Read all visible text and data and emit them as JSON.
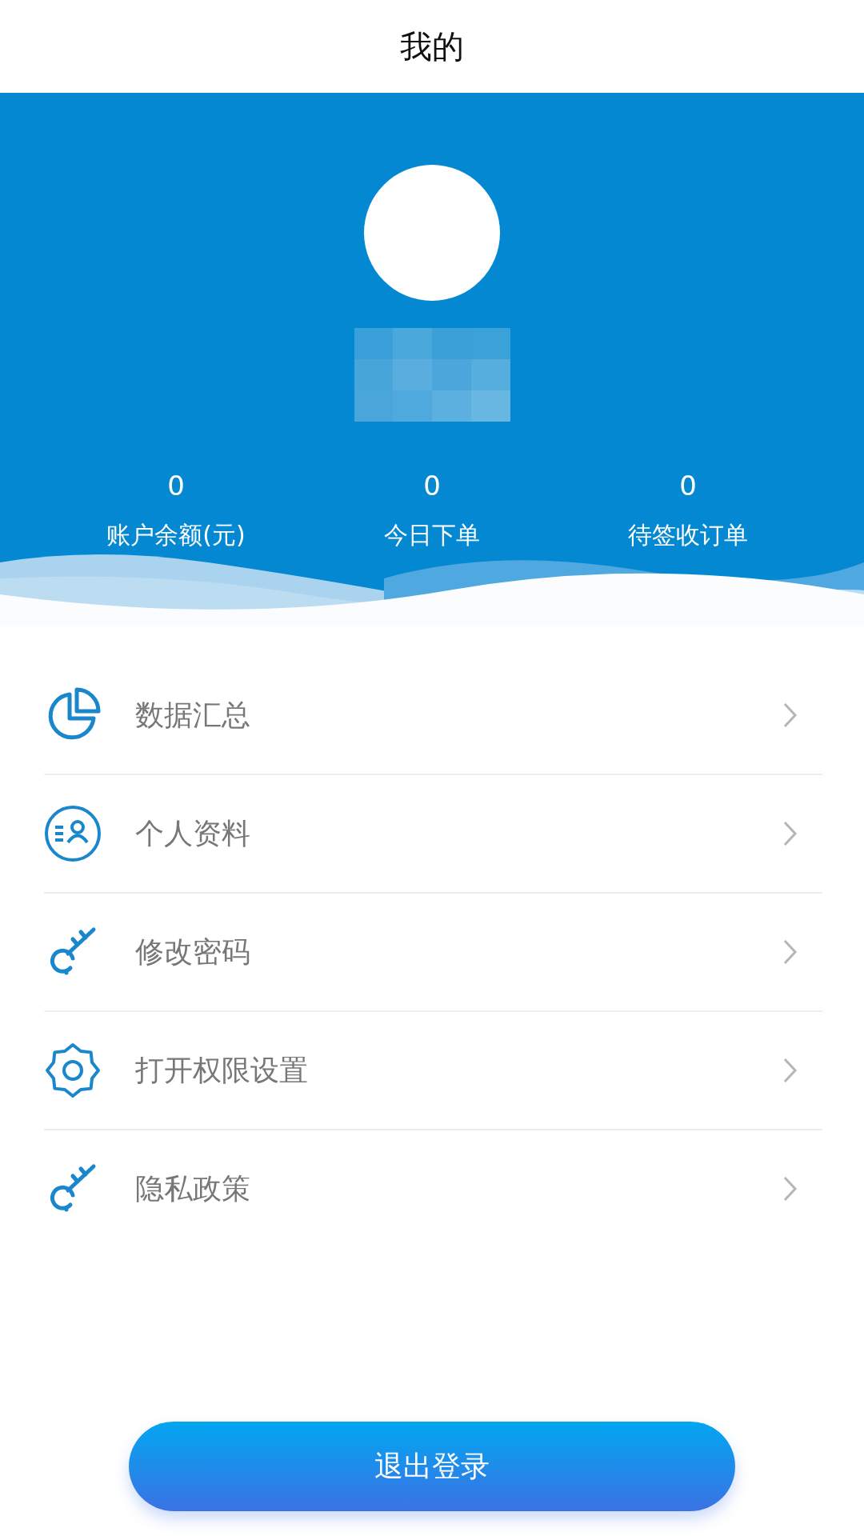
{
  "header": {
    "title": "我的"
  },
  "profile": {
    "name": {
      "kind": "pixelated"
    }
  },
  "stats": [
    {
      "value": "0",
      "label": "账户余额(元)"
    },
    {
      "value": "0",
      "label": "今日下单"
    },
    {
      "value": "0",
      "label": "待签收订单"
    }
  ],
  "menu": [
    {
      "kind": "chart",
      "label": "数据汇总"
    },
    {
      "kind": "profile",
      "label": "个人资料"
    },
    {
      "kind": "key",
      "label": "修改密码"
    },
    {
      "kind": "gear",
      "label": "打开权限设置"
    },
    {
      "kind": "key",
      "label": "隐私政策"
    }
  ],
  "logout_button": {
    "label": "退出登录"
  }
}
